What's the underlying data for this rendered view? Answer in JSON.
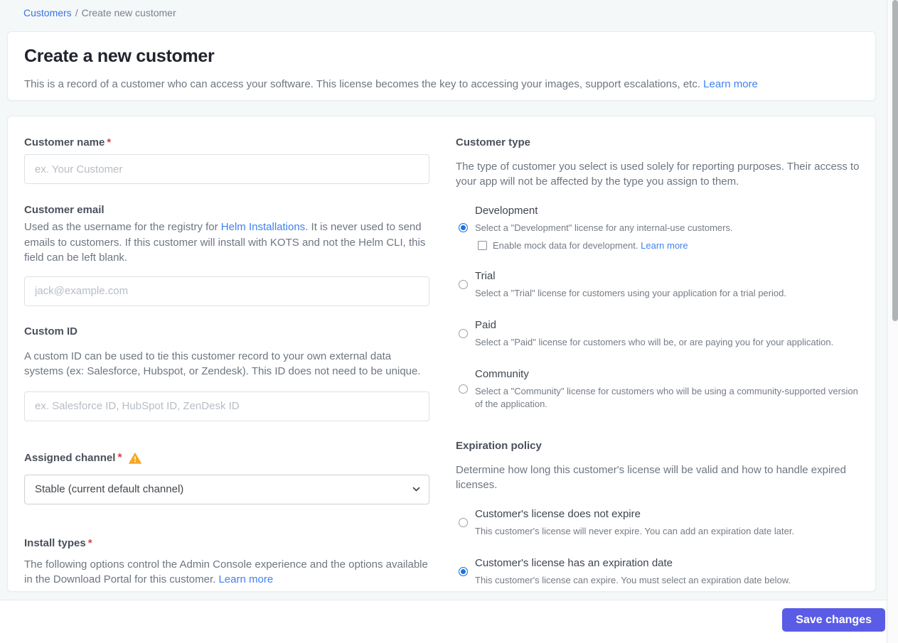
{
  "breadcrumb": {
    "link": "Customers",
    "separator": "/",
    "current": "Create new customer"
  },
  "header": {
    "title": "Create a new customer",
    "description": "This is a record of a customer who can access your software. This license becomes the key to accessing your images, support escalations, etc.",
    "learn_more": "Learn more"
  },
  "form": {
    "customer_name": {
      "label": "Customer name",
      "required": "*",
      "placeholder": "ex. Your Customer",
      "value": ""
    },
    "customer_email": {
      "label": "Customer email",
      "desc_before": "Used as the username for the registry for ",
      "desc_link": "Helm Installations",
      "desc_after": ". It is never used to send emails to customers. If this customer will install with KOTS and not the Helm CLI, this field can be left blank.",
      "placeholder": "jack@example.com",
      "value": ""
    },
    "custom_id": {
      "label": "Custom ID",
      "description": "A custom ID can be used to tie this customer record to your own external data systems (ex: Salesforce, Hubspot, or Zendesk). This ID does not need to be unique.",
      "placeholder": "ex. Salesforce ID, HubSpot ID, ZenDesk ID",
      "value": ""
    },
    "assigned_channel": {
      "label": "Assigned channel",
      "required": "*",
      "selected_option": "Stable (current default channel)",
      "warning_icon": "warning-triangle"
    },
    "install_types": {
      "label": "Install types",
      "required": "*",
      "description": "The following options control the Admin Console experience and the options available in the Download Portal for this customer. ",
      "learn_more": "Learn more"
    }
  },
  "customer_type": {
    "label": "Customer type",
    "description": "The type of customer you select is used solely for reporting purposes. Their access to your app will not be affected by the type you assign to them.",
    "options": [
      {
        "label": "Development",
        "description": "Select a \"Development\" license for any internal-use customers.",
        "selected": true,
        "checkbox": {
          "label": "Enable mock data for development. ",
          "learn_more": "Learn more",
          "checked": false
        }
      },
      {
        "label": "Trial",
        "description": "Select a \"Trial\" license for customers using your application for a trial period.",
        "selected": false
      },
      {
        "label": "Paid",
        "description": "Select a \"Paid\" license for customers who will be, or are paying you for your application.",
        "selected": false
      },
      {
        "label": "Community",
        "description": "Select a \"Community\" license for customers who will be using a community-supported version of the application.",
        "selected": false
      }
    ]
  },
  "expiration_policy": {
    "label": "Expiration policy",
    "description": "Determine how long this customer's license will be valid and how to handle expired licenses.",
    "options": [
      {
        "label": "Customer's license does not expire",
        "description": "This customer's license will never expire. You can add an expiration date later.",
        "selected": false
      },
      {
        "label": "Customer's license has an expiration date",
        "description": "This customer's license can expire. You must select an expiration date below.",
        "selected": true
      }
    ]
  },
  "footer": {
    "save_label": "Save changes"
  },
  "colors": {
    "page_bg": "#f4f8f9",
    "link_blue": "#3f82ef",
    "breadcrumb_blue": "#3b74dd",
    "radio_blue": "#1a73e8",
    "button_bg": "#5a5ce6",
    "warning_amber": "#f6a723",
    "asterisk_red": "#d6424f",
    "scroll_thumb": "#b0b4b6"
  }
}
